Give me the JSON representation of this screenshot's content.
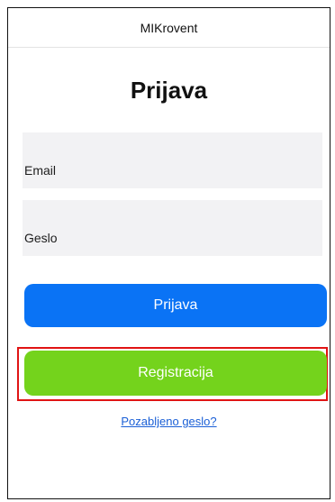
{
  "app": {
    "title": "MIKrovent"
  },
  "page": {
    "heading": "Prijava"
  },
  "form": {
    "email_placeholder": "Email",
    "password_placeholder": "Geslo",
    "login_label": "Prijava",
    "register_label": "Registracija",
    "forgot_label": "Pozabljeno geslo?"
  },
  "colors": {
    "login_button": "#0a73f5",
    "register_button": "#74d31c",
    "highlight_outline": "#e01414",
    "link": "#1a5fd6"
  }
}
